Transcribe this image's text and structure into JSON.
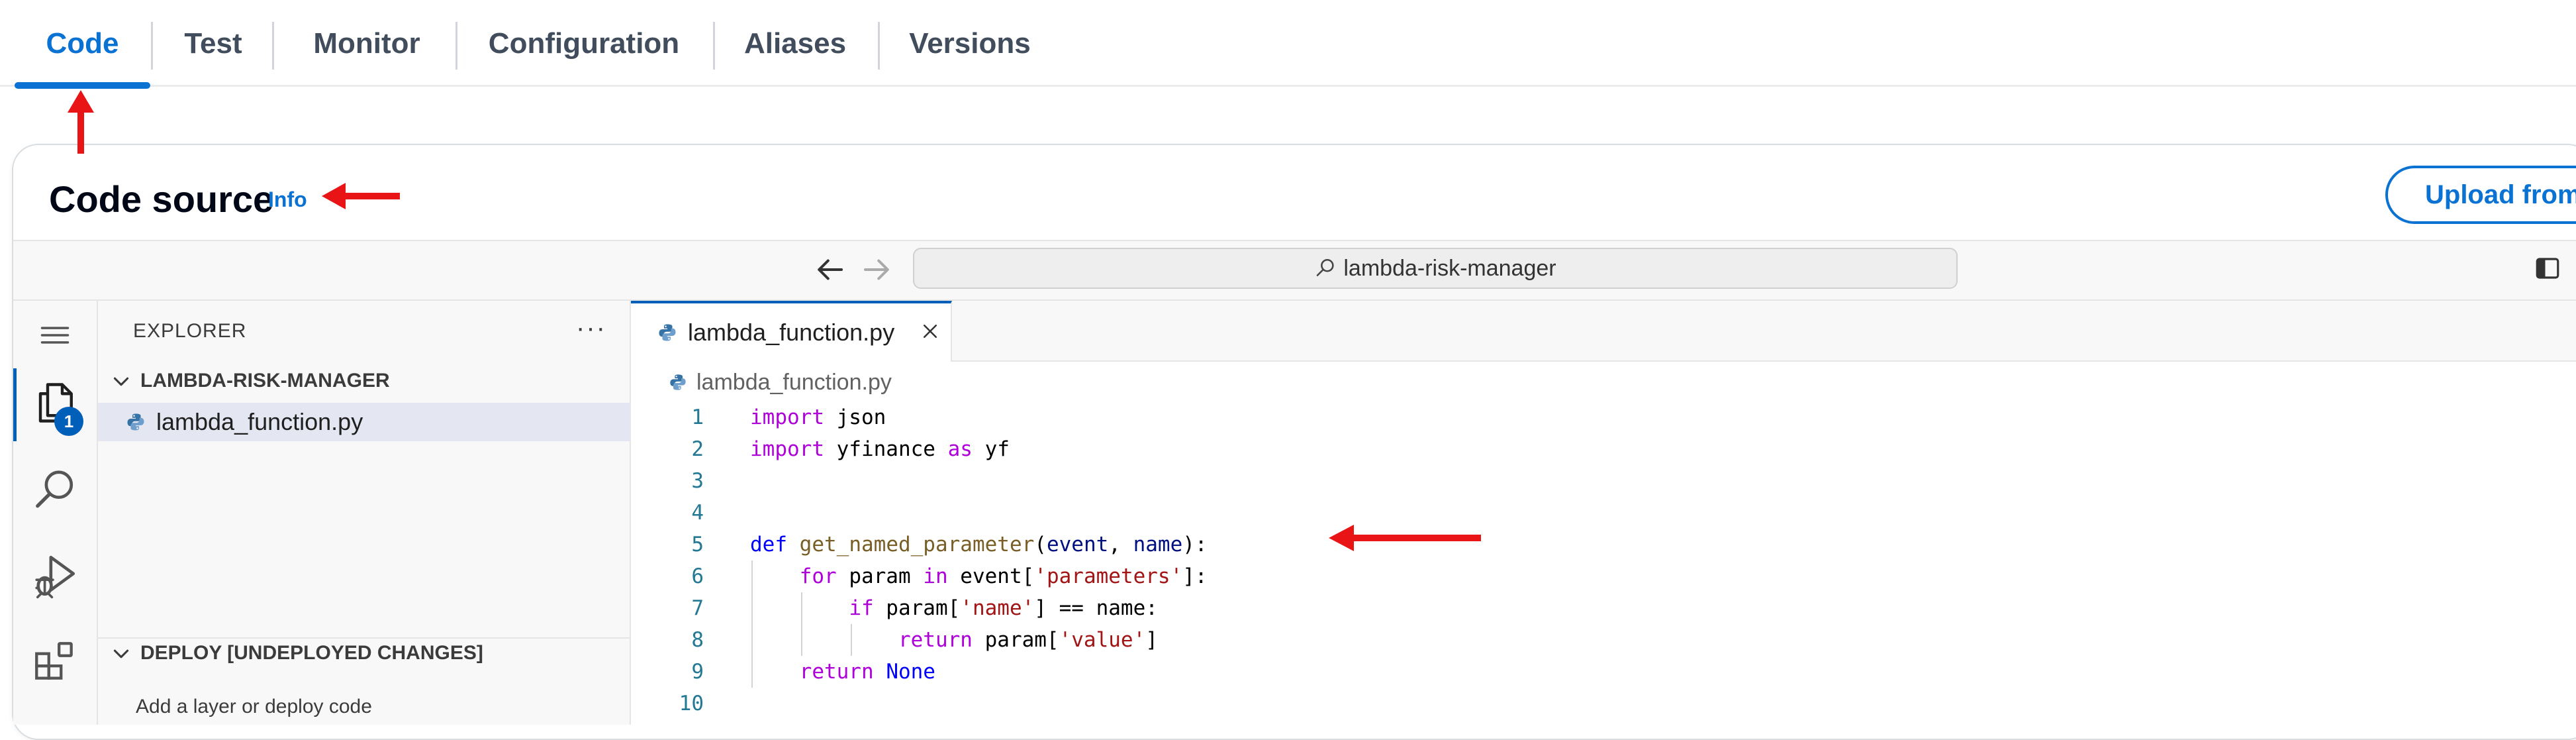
{
  "tabs": [
    {
      "label": "Code",
      "active": true
    },
    {
      "label": "Test",
      "active": false
    },
    {
      "label": "Monitor",
      "active": false
    },
    {
      "label": "Configuration",
      "active": false
    },
    {
      "label": "Aliases",
      "active": false
    },
    {
      "label": "Versions",
      "active": false
    }
  ],
  "header": {
    "title": "Code source",
    "info": "Info",
    "upload_button": "Upload from"
  },
  "titlebar": {
    "search_text": "lambda-risk-manager",
    "icons": [
      "arrow-left-icon",
      "arrow-right-icon",
      "search-icon",
      "toggle-sidebar-icon"
    ]
  },
  "activity_bar": {
    "icons": [
      "menu-icon",
      "explorer-icon",
      "search-icon",
      "run-debug-icon",
      "extensions-icon"
    ],
    "explorer_badge": "1"
  },
  "sidebar": {
    "title": "EXPLORER",
    "more": "···",
    "folder": "LAMBDA-RISK-MANAGER",
    "files": [
      "lambda_function.py"
    ],
    "deploy_section": "DEPLOY [UNDEPLOYED CHANGES]",
    "deploy_text": "Add a layer or deploy code"
  },
  "editor": {
    "tab_label": "lambda_function.py",
    "breadcrumb": "lambda_function.py",
    "line_numbers": [
      "1",
      "2",
      "3",
      "4",
      "5",
      "6",
      "7",
      "8",
      "9",
      "10"
    ],
    "lines": [
      [
        {
          "t": "import",
          "c": "kw"
        },
        {
          "t": " json",
          "c": ""
        }
      ],
      [
        {
          "t": "import",
          "c": "kw"
        },
        {
          "t": " yfinance ",
          "c": ""
        },
        {
          "t": "as",
          "c": "kw"
        },
        {
          "t": " yf",
          "c": ""
        }
      ],
      [],
      [],
      [
        {
          "t": "def",
          "c": "kw2"
        },
        {
          "t": " ",
          "c": ""
        },
        {
          "t": "get_named_parameter",
          "c": "fn"
        },
        {
          "t": "(",
          "c": ""
        },
        {
          "t": "event",
          "c": "pm"
        },
        {
          "t": ", ",
          "c": ""
        },
        {
          "t": "name",
          "c": "pm"
        },
        {
          "t": "):",
          "c": ""
        }
      ],
      [
        {
          "t": "    ",
          "c": ""
        },
        {
          "t": "for",
          "c": "kw"
        },
        {
          "t": " param ",
          "c": ""
        },
        {
          "t": "in",
          "c": "kw"
        },
        {
          "t": " event[",
          "c": ""
        },
        {
          "t": "'parameters'",
          "c": "str"
        },
        {
          "t": "]:",
          "c": ""
        }
      ],
      [
        {
          "t": "        ",
          "c": ""
        },
        {
          "t": "if",
          "c": "kw"
        },
        {
          "t": " param[",
          "c": ""
        },
        {
          "t": "'name'",
          "c": "str"
        },
        {
          "t": "] == name:",
          "c": ""
        }
      ],
      [
        {
          "t": "            ",
          "c": ""
        },
        {
          "t": "return",
          "c": "kw"
        },
        {
          "t": " param[",
          "c": ""
        },
        {
          "t": "'value'",
          "c": "str"
        },
        {
          "t": "]",
          "c": ""
        }
      ],
      [
        {
          "t": "    ",
          "c": ""
        },
        {
          "t": "return",
          "c": "kw"
        },
        {
          "t": " ",
          "c": ""
        },
        {
          "t": "None",
          "c": "kw2"
        }
      ],
      []
    ]
  },
  "colors": {
    "accent": "#0972d3",
    "annotation_arrow": "#e81416",
    "keyword": "#af00db",
    "keyword_def": "#0000ff",
    "function": "#795e26",
    "string": "#a31515",
    "line_number": "#237893"
  }
}
